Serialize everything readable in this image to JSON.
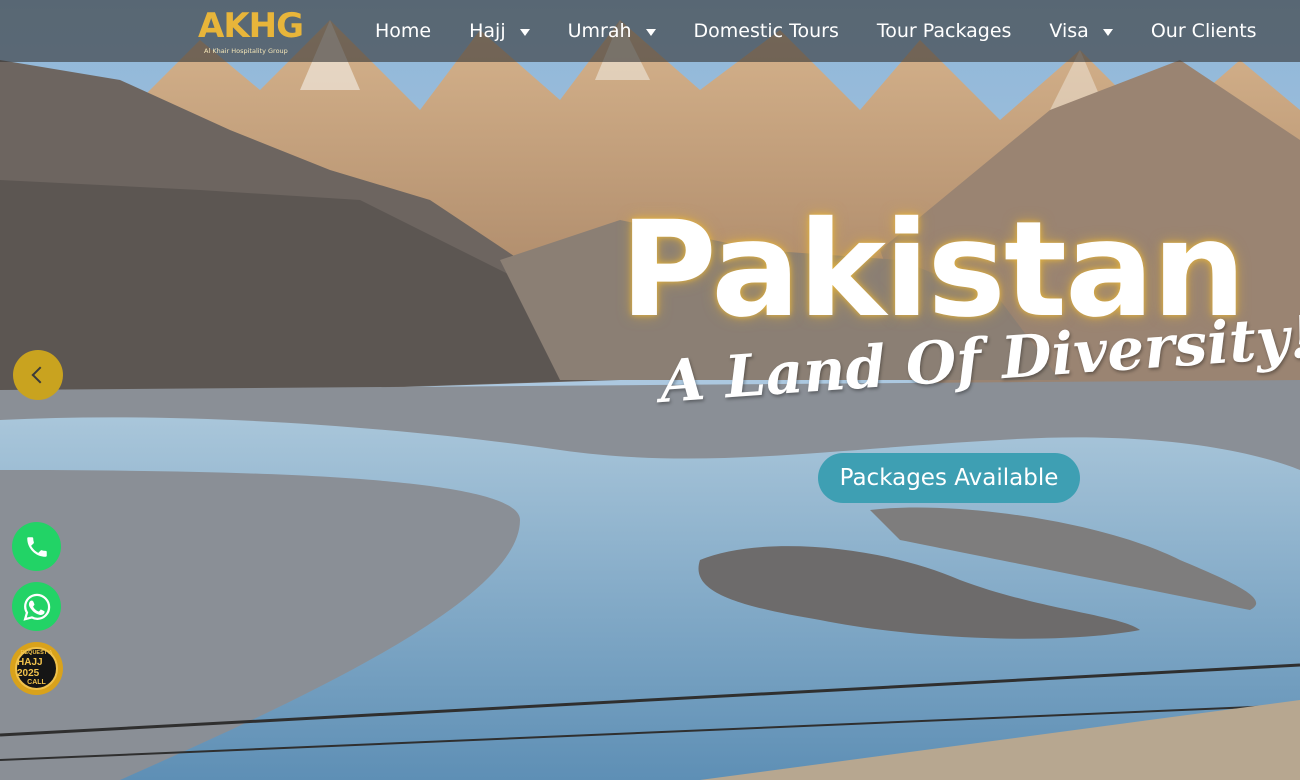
{
  "brand": {
    "logo_text": "AKHG",
    "logo_subtext": "Al Khair Hospitality Group",
    "accent_color": "#e8b53a"
  },
  "nav": {
    "items": [
      {
        "label": "Home",
        "has_dropdown": false
      },
      {
        "label": "Hajj",
        "has_dropdown": true
      },
      {
        "label": "Umrah",
        "has_dropdown": true
      },
      {
        "label": "Domestic Tours",
        "has_dropdown": false
      },
      {
        "label": "Tour Packages",
        "has_dropdown": false
      },
      {
        "label": "Visa",
        "has_dropdown": true
      },
      {
        "label": "Our Clients",
        "has_dropdown": false
      }
    ]
  },
  "hero": {
    "headline": "Pakistan",
    "tagline": "A Land Of Diversity!",
    "cta_label": "Packages Available",
    "cta_color": "#3e9fb3",
    "background": "Hunza valley mountain river with suspension bridge"
  },
  "slider": {
    "prev_icon": "chevron-left-icon"
  },
  "floating": {
    "phone_icon": "phone-icon",
    "whatsapp_icon": "whatsapp-icon",
    "hajj_badge": {
      "line1": "REQUEST A",
      "line2": "HAJJ 2025",
      "line3": "CALL"
    }
  }
}
